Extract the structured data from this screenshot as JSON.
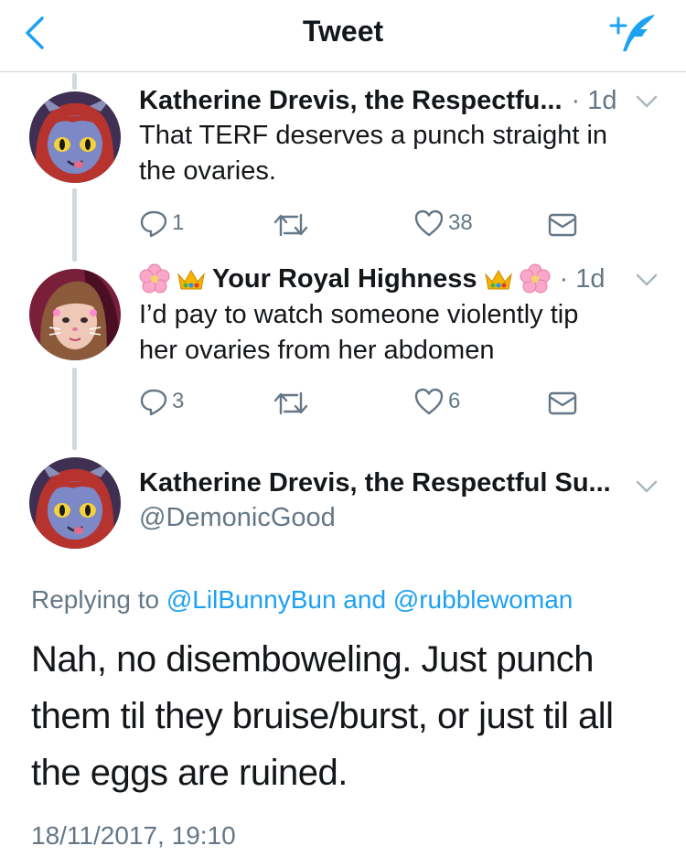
{
  "nav": {
    "title": "Tweet"
  },
  "colors": {
    "accent": "#1da1f2",
    "secondary_text": "#657786",
    "primary_text": "#14171a",
    "thread_line": "#cfd9de"
  },
  "replies": [
    {
      "name": "Katherine Drevis, the Respectfu...",
      "time": "· 1d",
      "text_lines": [
        "That TERF deserves a punch straight in",
        "the ovaries."
      ],
      "reply_count": "1",
      "retweet_count": "",
      "like_count": "38"
    },
    {
      "name_prefix_emojis": [
        "cherry-blossom",
        "crown"
      ],
      "name": "Your Royal Highness",
      "name_suffix_emojis": [
        "crown",
        "cherry-blossom"
      ],
      "time": "· 1d",
      "text_lines": [
        "I’d pay to watch someone violently tip",
        "her ovaries from her abdomen"
      ],
      "reply_count": "3",
      "retweet_count": "",
      "like_count": "6"
    }
  ],
  "main": {
    "name": "Katherine Drevis, the Respectful Su...",
    "handle": "@DemonicGood",
    "replying_prefix": "Replying to ",
    "replying_to_1": "@LilBunnyBun",
    "replying_and": " and ",
    "replying_to_2": "@rubblewoman",
    "text_lines": [
      "Nah, no disemboweling. Just punch",
      "them til they bruise/burst, or just til all",
      "the eggs are ruined."
    ],
    "timestamp": "18/11/2017, 19:10"
  }
}
